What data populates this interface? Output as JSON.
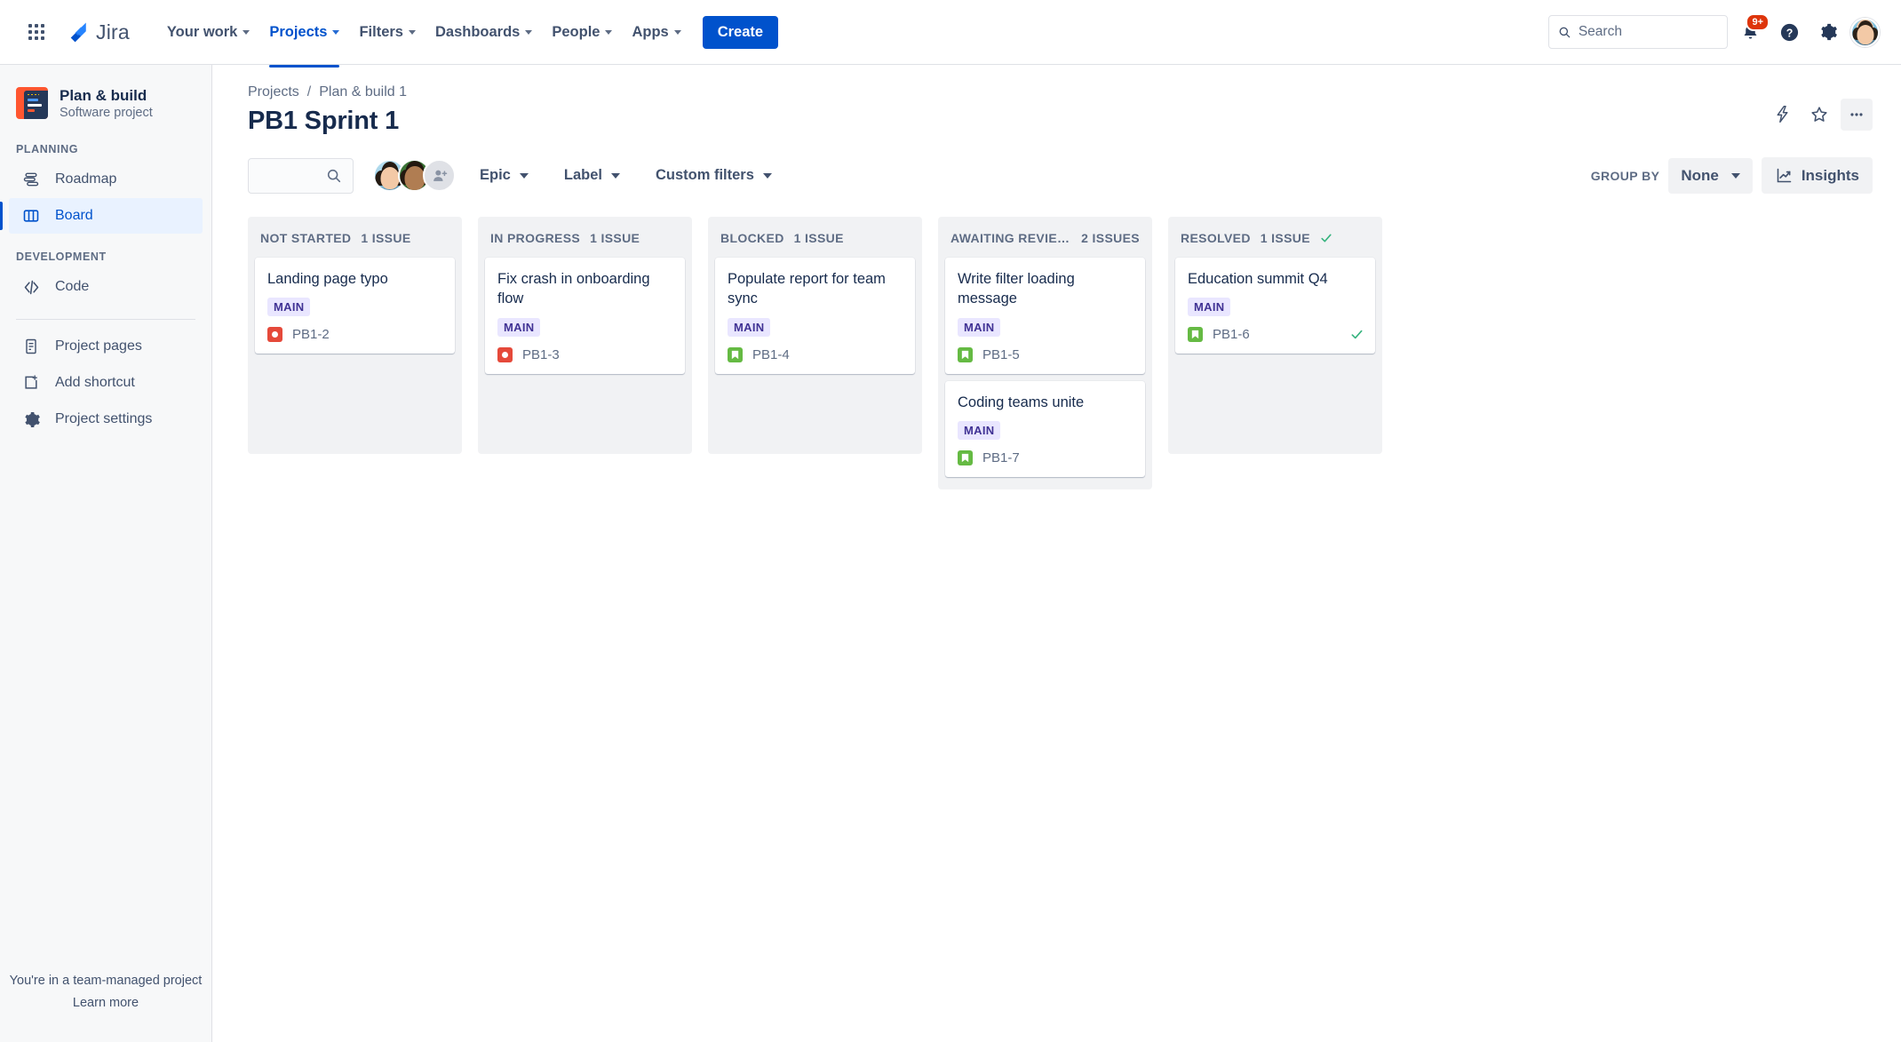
{
  "topnav": {
    "app_switcher_icon": "grid-apps-icon",
    "brand": "Jira",
    "items": [
      {
        "label": "Your work",
        "has_caret": true,
        "active": false
      },
      {
        "label": "Projects",
        "has_caret": true,
        "active": true
      },
      {
        "label": "Filters",
        "has_caret": true,
        "active": false
      },
      {
        "label": "Dashboards",
        "has_caret": true,
        "active": false
      },
      {
        "label": "People",
        "has_caret": true,
        "active": false
      },
      {
        "label": "Apps",
        "has_caret": true,
        "active": false
      }
    ],
    "create_label": "Create",
    "search_placeholder": "Search",
    "search_value": "",
    "notification_badge": "9+",
    "help_icon": "question-circle-icon",
    "settings_icon": "gear-icon",
    "avatar": "user-avatar"
  },
  "sidebar": {
    "project_name": "Plan & build",
    "project_type": "Software project",
    "section_planning": "PLANNING",
    "section_development": "DEVELOPMENT",
    "planning_items": [
      {
        "label": "Roadmap",
        "icon": "roadmap-icon",
        "active": false
      },
      {
        "label": "Board",
        "icon": "board-columns-icon",
        "active": true
      }
    ],
    "development_items": [
      {
        "label": "Code",
        "icon": "code-brackets-icon",
        "active": false
      }
    ],
    "other_items": [
      {
        "label": "Project pages",
        "icon": "page-document-icon"
      },
      {
        "label": "Add shortcut",
        "icon": "add-shortcut-icon"
      },
      {
        "label": "Project settings",
        "icon": "gear-icon"
      }
    ],
    "footer_line1": "You're in a team-managed project",
    "footer_line2": "Learn more"
  },
  "breadcrumb": {
    "items": [
      "Projects",
      "Plan & build 1"
    ],
    "separator": "/"
  },
  "page": {
    "title": "PB1 Sprint 1",
    "actions": [
      {
        "name": "lightning-bolt-icon"
      },
      {
        "name": "star-icon"
      },
      {
        "name": "more-actions-icon"
      }
    ]
  },
  "toolbar": {
    "search_value": "",
    "search_placeholder": "",
    "search_icon": "search-icon",
    "add_people_icon": "add-person-icon",
    "dropdowns": [
      {
        "label": "Epic"
      },
      {
        "label": "Label"
      },
      {
        "label": "Custom filters"
      }
    ],
    "group_by_label": "GROUP BY",
    "group_by_value": "None",
    "insights_label": "Insights",
    "insights_icon": "insights-chart-icon"
  },
  "board": {
    "columns": [
      {
        "name": "NOT STARTED",
        "count": "1 ISSUE",
        "done": false,
        "cards": [
          {
            "title": "Landing page typo",
            "tag": "MAIN",
            "key": "PB1-2",
            "type": "bug",
            "done": false
          }
        ]
      },
      {
        "name": "IN PROGRESS",
        "count": "1 ISSUE",
        "done": false,
        "cards": [
          {
            "title": "Fix crash in onboarding flow",
            "tag": "MAIN",
            "key": "PB1-3",
            "type": "bug",
            "done": false
          }
        ]
      },
      {
        "name": "BLOCKED",
        "count": "1 ISSUE",
        "done": false,
        "cards": [
          {
            "title": "Populate report for team sync",
            "tag": "MAIN",
            "key": "PB1-4",
            "type": "story",
            "done": false
          }
        ]
      },
      {
        "name": "AWAITING REVIEW/T…",
        "count": "2 ISSUES",
        "done": false,
        "cards": [
          {
            "title": "Write filter loading message",
            "tag": "MAIN",
            "key": "PB1-5",
            "type": "story",
            "done": false
          },
          {
            "title": "Coding teams unite",
            "tag": "MAIN",
            "key": "PB1-7",
            "type": "story",
            "done": false
          }
        ]
      },
      {
        "name": "RESOLVED",
        "count": "1 ISSUE",
        "done": true,
        "cards": [
          {
            "title": "Education summit Q4",
            "tag": "MAIN",
            "key": "PB1-6",
            "type": "story",
            "done": true
          }
        ]
      }
    ]
  },
  "colors": {
    "accent": "#0052CC",
    "bug": "#E5493A",
    "story": "#65BA43",
    "tag_bg": "#E9E6FF",
    "tag_fg": "#403294",
    "badge": "#DE350B",
    "done_check": "#36B37E"
  }
}
